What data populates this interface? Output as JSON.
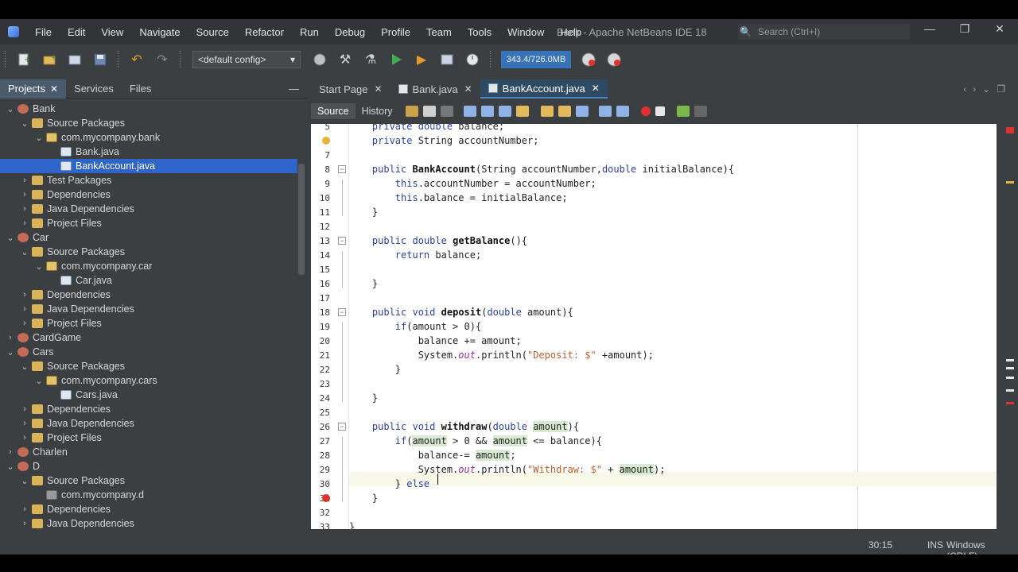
{
  "window": {
    "title": "Bank - Apache NetBeans IDE 18",
    "search_placeholder": "Search (Ctrl+I)",
    "menu": [
      "File",
      "Edit",
      "View",
      "Navigate",
      "Source",
      "Refactor",
      "Run",
      "Debug",
      "Profile",
      "Team",
      "Tools",
      "Window",
      "Help"
    ],
    "controls": {
      "minimize": "—",
      "restore": "❐",
      "close": "✕"
    }
  },
  "toolbar": {
    "config_value": "<default config>",
    "memory": "343.4/726.0MB",
    "icons": [
      "new-file-icon",
      "new-project-icon",
      "open-project-icon",
      "save-all-icon",
      "undo-icon",
      "redo-icon",
      "globe-icon",
      "build-icon",
      "clean-build-icon",
      "run-icon",
      "debug-icon",
      "profile-icon",
      "history-icon",
      "gc-icon",
      "profiler-icon"
    ]
  },
  "project_panel": {
    "tabs": [
      "Projects",
      "Services",
      "Files"
    ],
    "active_tab": "Projects",
    "tree": [
      {
        "label": "Bank",
        "type": "project",
        "level": 0,
        "expanded": true
      },
      {
        "label": "Source Packages",
        "type": "folder",
        "level": 1,
        "expanded": true
      },
      {
        "label": "com.mycompany.bank",
        "type": "pkg",
        "level": 2,
        "expanded": true
      },
      {
        "label": "Bank.java",
        "type": "java",
        "level": 3
      },
      {
        "label": "BankAccount.java",
        "type": "java",
        "level": 3,
        "selected": true
      },
      {
        "label": "Test Packages",
        "type": "folder",
        "level": 1,
        "expanded": false
      },
      {
        "label": "Dependencies",
        "type": "folder",
        "level": 1,
        "expanded": false
      },
      {
        "label": "Java Dependencies",
        "type": "folder",
        "level": 1,
        "expanded": false
      },
      {
        "label": "Project Files",
        "type": "folder",
        "level": 1,
        "expanded": false
      },
      {
        "label": "Car",
        "type": "project",
        "level": 0,
        "expanded": true
      },
      {
        "label": "Source Packages",
        "type": "folder",
        "level": 1,
        "expanded": true
      },
      {
        "label": "com.mycompany.car",
        "type": "pkg",
        "level": 2,
        "expanded": true
      },
      {
        "label": "Car.java",
        "type": "java",
        "level": 3
      },
      {
        "label": "Dependencies",
        "type": "folder",
        "level": 1,
        "expanded": false
      },
      {
        "label": "Java Dependencies",
        "type": "folder",
        "level": 1,
        "expanded": false
      },
      {
        "label": "Project Files",
        "type": "folder",
        "level": 1,
        "expanded": false
      },
      {
        "label": "CardGame",
        "type": "project",
        "level": 0,
        "expanded": false
      },
      {
        "label": "Cars",
        "type": "project",
        "level": 0,
        "expanded": true
      },
      {
        "label": "Source Packages",
        "type": "folder",
        "level": 1,
        "expanded": true
      },
      {
        "label": "com.mycompany.cars",
        "type": "pkg",
        "level": 2,
        "expanded": true
      },
      {
        "label": "Cars.java",
        "type": "java",
        "level": 3
      },
      {
        "label": "Dependencies",
        "type": "folder",
        "level": 1,
        "expanded": false
      },
      {
        "label": "Java Dependencies",
        "type": "folder",
        "level": 1,
        "expanded": false
      },
      {
        "label": "Project Files",
        "type": "folder",
        "level": 1,
        "expanded": false
      },
      {
        "label": "Charlen",
        "type": "project",
        "level": 0,
        "expanded": false
      },
      {
        "label": "D",
        "type": "project",
        "level": 0,
        "expanded": true
      },
      {
        "label": "Source Packages",
        "type": "folder",
        "level": 1,
        "expanded": true
      },
      {
        "label": "com.mycompany.d",
        "type": "pkg-empty",
        "level": 2
      },
      {
        "label": "Dependencies",
        "type": "folder",
        "level": 1,
        "expanded": false
      },
      {
        "label": "Java Dependencies",
        "type": "folder",
        "level": 1,
        "expanded": false
      }
    ]
  },
  "editor": {
    "tabs": [
      "Start Page",
      "Bank.java",
      "BankAccount.java"
    ],
    "active_tab": "BankAccount.java",
    "modes": [
      "Source",
      "History"
    ],
    "active_mode": "Source",
    "lines": [
      {
        "n": "5",
        "text": "    private double balance;"
      },
      {
        "n": "6",
        "text": "    private String accountNumber;"
      },
      {
        "n": "7",
        "text": ""
      },
      {
        "n": "8",
        "text": "    public BankAccount(String accountNumber,double initialBalance){"
      },
      {
        "n": "9",
        "text": "        this.accountNumber = accountNumber;"
      },
      {
        "n": "10",
        "text": "        this.balance = initialBalance;"
      },
      {
        "n": "11",
        "text": "    }"
      },
      {
        "n": "12",
        "text": ""
      },
      {
        "n": "13",
        "text": "    public double getBalance(){"
      },
      {
        "n": "14",
        "text": "        return balance;"
      },
      {
        "n": "15",
        "text": ""
      },
      {
        "n": "16",
        "text": "    }"
      },
      {
        "n": "17",
        "text": ""
      },
      {
        "n": "18",
        "text": "    public void deposit(double amount){"
      },
      {
        "n": "19",
        "text": "        if(amount > 0){"
      },
      {
        "n": "20",
        "text": "            balance += amount;"
      },
      {
        "n": "21",
        "text": "            System.out.println(\"Deposit: $\" +amount);"
      },
      {
        "n": "22",
        "text": "        }"
      },
      {
        "n": "23",
        "text": ""
      },
      {
        "n": "24",
        "text": "    }"
      },
      {
        "n": "25",
        "text": ""
      },
      {
        "n": "26",
        "text": "    public void withdraw(double amount){"
      },
      {
        "n": "27",
        "text": "        if(amount > 0 && amount <= balance){"
      },
      {
        "n": "28",
        "text": "            balance-= amount;"
      },
      {
        "n": "29",
        "text": "            System.out.println(\"Withdraw: $\" + amount);"
      },
      {
        "n": "30",
        "text": "        } else"
      },
      {
        "n": "31",
        "text": "    }"
      },
      {
        "n": "32",
        "text": ""
      },
      {
        "n": "33",
        "text": "}"
      }
    ]
  },
  "statusbar": {
    "position": "30:15",
    "insert_mode": "INS",
    "line_ending": "Windows (CRLF)"
  },
  "colors": {
    "accent": "#2f65ca",
    "memory_bar": "#3873b8",
    "error": "#e0302f"
  }
}
